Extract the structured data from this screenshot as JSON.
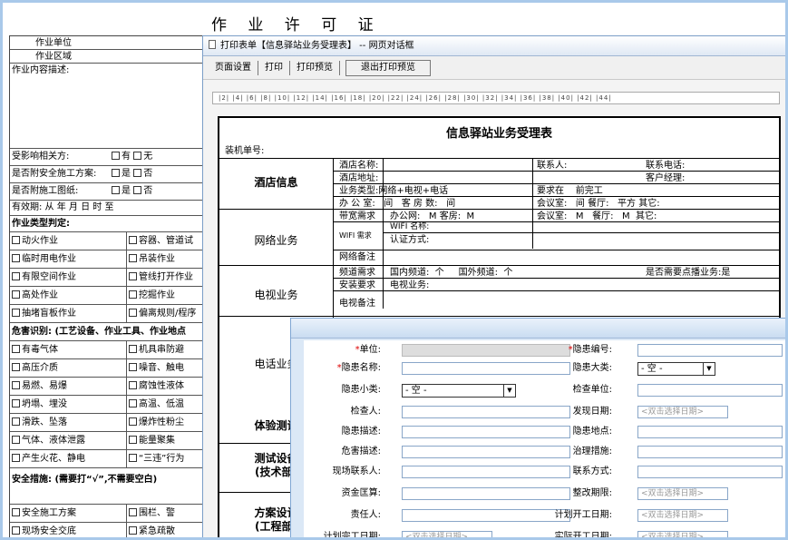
{
  "page_title": "作 业 许 可 证",
  "left_form": {
    "rows": [
      "作业单位",
      "作业区域",
      "作业内容描述:",
      "受影响相关方:",
      "是否附安全施工方案:",
      "是否附施工图纸:",
      "有效期: 从  年  月  日  时  至",
      "作业类型判定:",
      "危害识别: (工艺设备、作业工具、作业地点",
      "安全措施: (需要打“√”,不需要空白)"
    ],
    "yes": "有",
    "no": "无",
    "is": "是",
    "isnot": "否",
    "types": [
      [
        "动火作业",
        "容器、管道试"
      ],
      [
        "临时用电作业",
        "吊装作业"
      ],
      [
        "有限空间作业",
        "管线打开作业"
      ],
      [
        "高处作业",
        "挖掘作业"
      ],
      [
        "抽堵盲板作业",
        "偏离规则/程序"
      ]
    ],
    "hazards": [
      [
        "有毒气体",
        "机具串防避"
      ],
      [
        "高压介质",
        "噪音、触电"
      ],
      [
        "易燃、易爆",
        "腐蚀性液体"
      ],
      [
        "坍塌、埋没",
        "高温、低温"
      ],
      [
        "滑跌、坠落",
        "爆炸性粉尘"
      ],
      [
        "气体、液体泄露",
        "能量聚集"
      ],
      [
        "产生火花、静电",
        "“三违”行为"
      ]
    ],
    "measures": [
      [
        "安全施工方案",
        "围栏、警"
      ],
      [
        "现场安全交底",
        "紧急疏散"
      ]
    ]
  },
  "print_window": {
    "titlebar": "打印表单【信息驿站业务受理表】 -- 网页对话框",
    "menu": [
      "页面设置",
      "打印",
      "打印预览",
      "退出打印预览"
    ],
    "ruler": "|2|  |4|  |6|  |8|  |10|  |12|  |14|  |16|  |18|  |20|  |22|  |24|  |26|  |28|  |30|  |32|  |34|  |36|  |38|  |40|  |42|  |44|",
    "doc": {
      "title": "信息驿站业务受理表",
      "install_no": "装机单号:",
      "sections": [
        "酒店信息",
        "网络业务",
        "电视业务",
        "电话业务",
        "体验测试",
        "测试设备\n(技术部)",
        "方案设计\n(工程部)"
      ],
      "hotel": {
        "name": "酒店名称:",
        "contact": "联系人:",
        "phone": "联系电话:",
        "address": "酒店地址:",
        "manager": "客户经理:",
        "btype": "业务类型:",
        "btype_val": "网络+电视+电话",
        "req": "要求在",
        "req_val": "前完工",
        "office": "办 公 室:",
        "office_unit": "间",
        "rooms": "客 房 数:",
        "rooms_unit": "间",
        "meeting": "会议室:",
        "meeting_unit": "间",
        "dining": "餐厅:",
        "dining_unit": "平方",
        "other": "其它:"
      },
      "net": {
        "bw": "带宽需求",
        "office_net": "办公网:",
        "m1": "M",
        "rooms": "客房:",
        "m2": "M",
        "meeting": "会议室:",
        "m3": "M",
        "dining": "餐厅:",
        "m4": "M",
        "other": "其它:",
        "wifi": "WIFI 需求",
        "wifi_name": "WIFI 名称:",
        "auth": "认证方式:",
        "note": "网络备注"
      },
      "tv": {
        "channel": "频道需求",
        "domestic": "国内频道:",
        "d_unit": "个",
        "foreign": "国外频道:",
        "f_unit": "个",
        "paid": "是否需要点播业务:是",
        "install": "安装要求",
        "tv_biz": "电视业务:",
        "note": "电视备注"
      }
    }
  },
  "popup": {
    "fields": [
      {
        "label": "单位:",
        "req": true,
        "kind": "gray"
      },
      {
        "label": "隐患编号:",
        "req": true,
        "kind": "input"
      },
      {
        "label": "隐患名称:",
        "req": true,
        "kind": "input"
      },
      {
        "label": "隐患大类:",
        "req": false,
        "kind": "select",
        "value": "- 空 -"
      },
      {
        "label": "隐患小类:",
        "req": false,
        "kind": "select",
        "value": "- 空 -"
      },
      {
        "label": "检查单位:",
        "req": false,
        "kind": "input"
      },
      {
        "label": "检查人:",
        "req": false,
        "kind": "input"
      },
      {
        "label": "发现日期:",
        "req": false,
        "kind": "date",
        "value": "<双击选择日期>"
      },
      {
        "label": "隐患描述:",
        "req": false,
        "kind": "input"
      },
      {
        "label": "隐患地点:",
        "req": false,
        "kind": "input"
      },
      {
        "label": "危害描述:",
        "req": false,
        "kind": "input"
      },
      {
        "label": "治理措施:",
        "req": false,
        "kind": "input"
      },
      {
        "label": "现场联系人:",
        "req": false,
        "kind": "input"
      },
      {
        "label": "联系方式:",
        "req": false,
        "kind": "input"
      },
      {
        "label": "资金匡算:",
        "req": false,
        "kind": "input"
      },
      {
        "label": "整改期限:",
        "req": false,
        "kind": "date",
        "value": "<双击选择日期>"
      },
      {
        "label": "责任人:",
        "req": false,
        "kind": "input"
      },
      {
        "label": "计划开工日期:",
        "req": false,
        "kind": "date",
        "value": "<双击选择日期>"
      },
      {
        "label": "计划完工日期:",
        "req": false,
        "kind": "date",
        "value": "<双击选择日期>"
      },
      {
        "label": "实际开工日期:",
        "req": false,
        "kind": "date",
        "value": "<双击选择日期>"
      }
    ]
  }
}
